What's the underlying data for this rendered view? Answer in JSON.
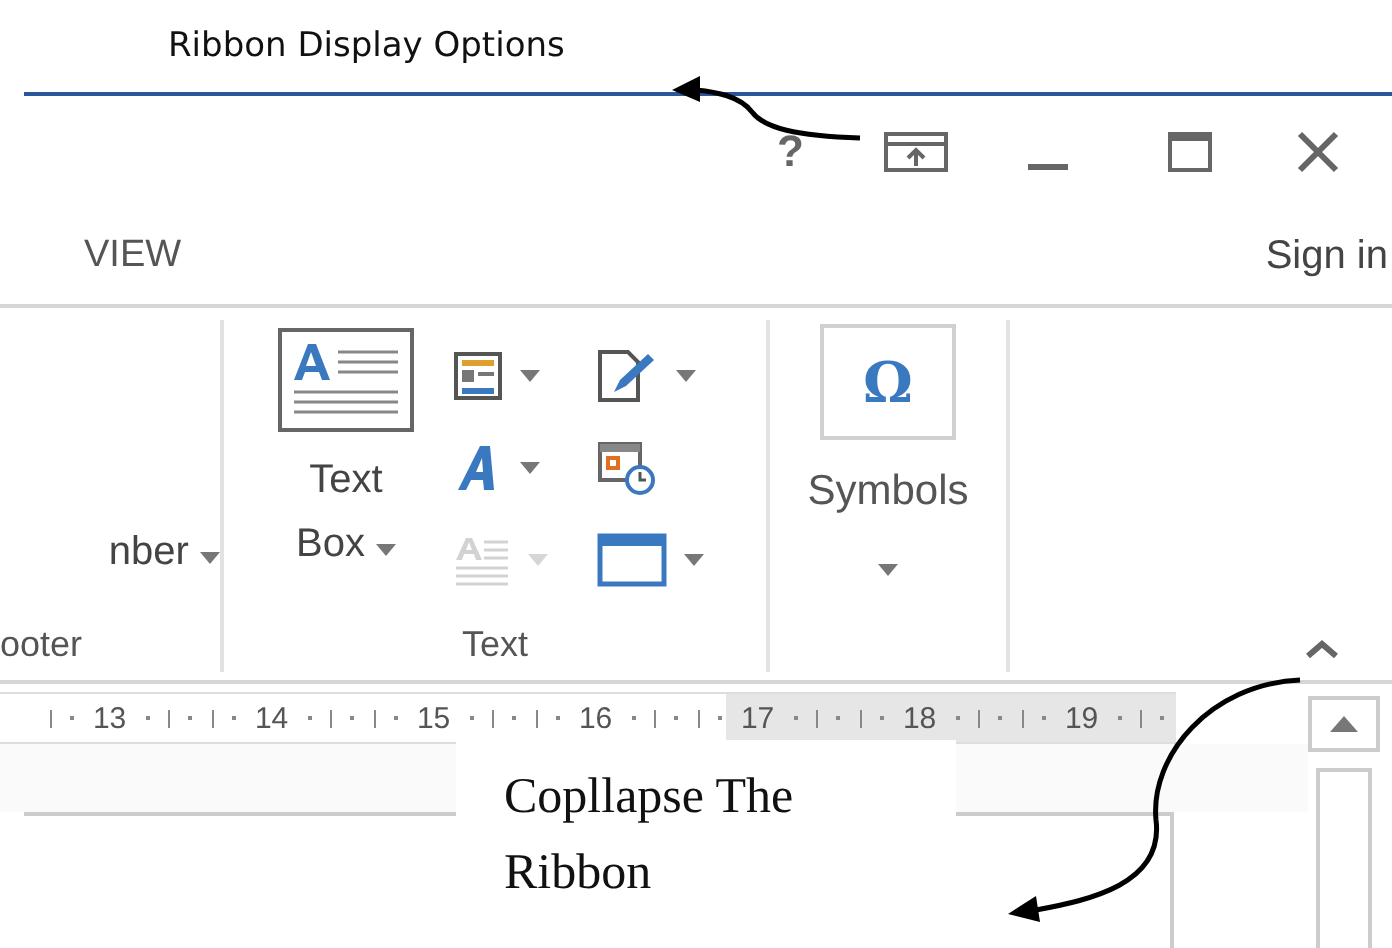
{
  "annotations": [
    {
      "text": "Ribbon Display Options"
    },
    {
      "text": "Copllapse The Ribbon"
    }
  ],
  "title_bar": {
    "help": "?"
  },
  "tabs": [
    {
      "label": "VIEW"
    }
  ],
  "sign_in": "Sign in",
  "ribbon": {
    "partial_group": {
      "button": "nber",
      "label": "ooter"
    },
    "text_group": {
      "big_button": "Text Box",
      "label": "Text",
      "small_tools": [
        {
          "kind": "parts",
          "disabled": false
        },
        {
          "kind": "signature",
          "disabled": false
        },
        {
          "kind": "wordart",
          "disabled": false
        },
        {
          "kind": "datetime",
          "disabled": false
        },
        {
          "kind": "dropcap",
          "disabled": true
        },
        {
          "kind": "object",
          "disabled": false
        }
      ]
    },
    "symbols_icon": "Ω",
    "symbols_button": "Symbols"
  },
  "ruler": {
    "numbers": [
      "13",
      "14",
      "15",
      "16",
      "17",
      "18",
      "19"
    ]
  }
}
